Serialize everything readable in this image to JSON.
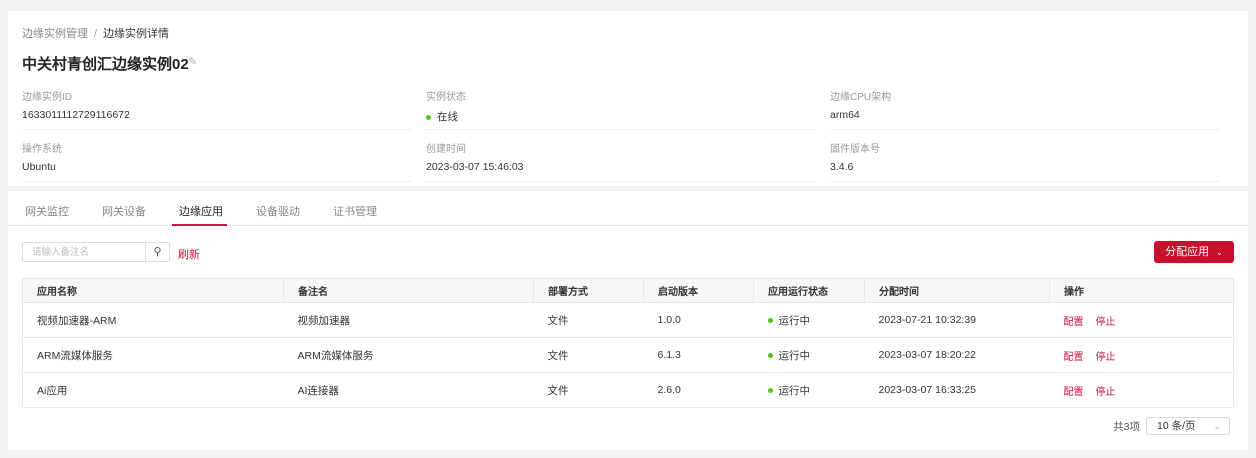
{
  "breadcrumb": {
    "parent": "边缘实例管理",
    "separator": "/",
    "current": "边缘实例详情"
  },
  "title": "中关村青创汇边缘实例02",
  "info": [
    {
      "label": "边缘实例ID",
      "value": "1633011112729116672"
    },
    {
      "label": "实例状态",
      "value": "在线"
    },
    {
      "label": "边缘CPU架构",
      "value": "arm64"
    },
    {
      "label": "操作系统",
      "value": "Ubuntu"
    },
    {
      "label": "创建时间",
      "value": "2023-03-07 15:46:03"
    },
    {
      "label": "固件版本号",
      "value": "3.4.6"
    }
  ],
  "tabs": [
    "网关监控",
    "网关设备",
    "边缘应用",
    "设备驱动",
    "证书管理"
  ],
  "active_tab": "边缘应用",
  "toolbar": {
    "search_placeholder": "请输入备注名",
    "refresh": "刷新",
    "assign": "分配应用"
  },
  "table": {
    "headers": [
      "应用名称",
      "备注名",
      "部署方式",
      "启动版本",
      "应用运行状态",
      "分配时间",
      "操作"
    ],
    "rows": [
      {
        "name": "视频加速器-ARM",
        "remark": "视频加速器",
        "deploy": "文件",
        "version": "1.0.0",
        "status": "运行中",
        "time": "2023-07-21 10:32:39"
      },
      {
        "name": "ARM流媒体服务",
        "remark": "ARM流媒体服务",
        "deploy": "文件",
        "version": "6.1.3",
        "status": "运行中",
        "time": "2023-03-07 18:20:22"
      },
      {
        "name": "Ai应用",
        "remark": "AI连接器",
        "deploy": "文件",
        "version": "2.6.0",
        "status": "运行中",
        "time": "2023-03-07 16:33:25"
      }
    ],
    "actions": {
      "config": "配置",
      "stop": "停止"
    }
  },
  "pagination": {
    "total": "共3项",
    "page_size": "10 条/页"
  },
  "colors": {
    "accent": "#c8102e",
    "online": "#52c41a"
  }
}
